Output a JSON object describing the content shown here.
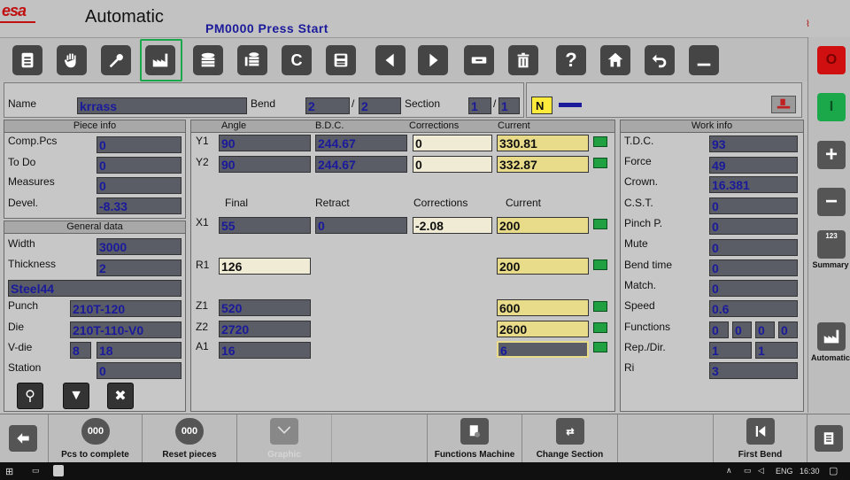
{
  "header": {
    "logo": "esa",
    "mode": "Automatic",
    "program": "PM0000 Press Start"
  },
  "toolbar": {
    "buttons": [
      "document-icon",
      "hand-icon",
      "wrench-icon",
      "factory-icon",
      "disk-stack-icon",
      "database-icon",
      "c-icon",
      "save-icon",
      "prev-icon",
      "next-icon",
      "minus-rect-icon",
      "trash-icon",
      "help-icon",
      "home-icon",
      "undo-icon",
      "minimize-icon"
    ],
    "help_glyph": "?",
    "c_glyph": "C"
  },
  "namebar": {
    "name_label": "Name",
    "name_value": "krrass",
    "bend_label": "Bend",
    "bend_value": "2",
    "bend_total": "2",
    "slash": "/",
    "section_label": "Section",
    "section_value": "1",
    "section_total": "1",
    "n_badge": "N"
  },
  "piece_info": {
    "title": "Piece info",
    "rows": [
      {
        "label": "Comp.Pcs",
        "value": "0"
      },
      {
        "label": "To Do",
        "value": "0"
      },
      {
        "label": "Measures",
        "value": "0"
      },
      {
        "label": "Devel.",
        "value": "-8.33"
      }
    ]
  },
  "general_data": {
    "title": "General data",
    "width_label": "Width",
    "width_value": "3000",
    "thickness_label": "Thickness",
    "thickness_value": "2",
    "material": "Steel44",
    "punch_label": "Punch",
    "punch_value": "210T-120",
    "die_label": "Die",
    "die_value": "210T-110-V0",
    "vdie_label": "V-die",
    "vdie_a": "8",
    "vdie_b": "18",
    "station_label": "Station",
    "station_value": "0"
  },
  "axes": {
    "headers": {
      "angle": "Angle",
      "bdc": "B.D.C.",
      "corrections": "Corrections",
      "current": "Current"
    },
    "y1": {
      "label": "Y1",
      "angle": "90",
      "bdc": "244.67",
      "corr": "0",
      "current": "330.81"
    },
    "y2": {
      "label": "Y2",
      "angle": "90",
      "bdc": "244.67",
      "corr": "0",
      "current": "332.87"
    },
    "headers2": {
      "final": "Final",
      "retract": "Retract",
      "corrections": "Corrections",
      "current": "Current"
    },
    "x1": {
      "label": "X1",
      "final": "55",
      "retract": "0",
      "corr": "-2.08",
      "current": "200"
    },
    "r1": {
      "label": "R1",
      "final": "126",
      "current": "200"
    },
    "z1": {
      "label": "Z1",
      "final": "520",
      "current": "600"
    },
    "z2": {
      "label": "Z2",
      "final": "2720",
      "current": "2600"
    },
    "a1": {
      "label": "A1",
      "final": "16",
      "current": "6"
    }
  },
  "work_info": {
    "title": "Work info",
    "rows": [
      {
        "label": "T.D.C.",
        "value": "93"
      },
      {
        "label": "Force",
        "value": "49"
      },
      {
        "label": "Crown.",
        "value": "16.381"
      },
      {
        "label": "C.S.T.",
        "value": "0"
      },
      {
        "label": "Pinch P.",
        "value": "0"
      },
      {
        "label": "Mute",
        "value": "0"
      },
      {
        "label": "Bend time",
        "value": "0"
      },
      {
        "label": "Match.",
        "value": "0"
      },
      {
        "label": "Speed",
        "value": "0.6"
      }
    ],
    "functions_label": "Functions",
    "functions_values": [
      "0",
      "0",
      "0",
      "0"
    ],
    "repdir_label": "Rep./Dir.",
    "repdir_values": [
      "1",
      "1"
    ],
    "ri_label": "Ri",
    "ri_value": "3"
  },
  "right_panel": {
    "stop_glyph": "O",
    "start_glyph": "I",
    "plus_glyph": "+",
    "minus_glyph": "−",
    "summary_label": "Summary",
    "summary_glyph": "123",
    "automatic_label": "Automatic"
  },
  "bottom_bar": {
    "pcs_complete": "Pcs to complete",
    "reset_pieces": "Reset pieces",
    "graphic": "Graphic",
    "functions_machine": "Functions Machine",
    "change_section": "Change Section",
    "first_bend": "First Bend",
    "counter_glyph": "000"
  },
  "taskbar": {
    "lang": "ENG",
    "time": "16:30"
  },
  "colors": {
    "accent_green": "#1aa84a",
    "stop_red": "#d01010",
    "value_blue": "#1a1a9a",
    "current_yellow": "#e8db8a"
  }
}
